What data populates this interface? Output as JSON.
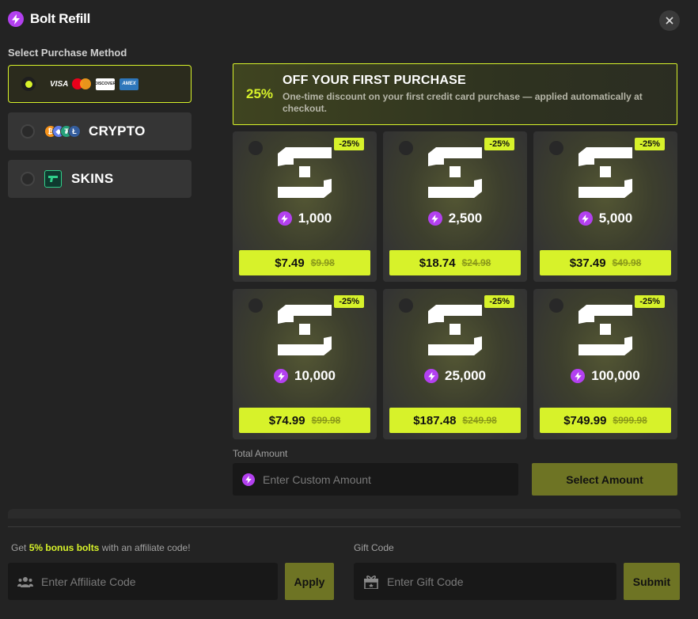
{
  "header": {
    "title": "Bolt Refill",
    "icon": "bolt-icon",
    "close_icon": "close-icon"
  },
  "purchase_method": {
    "label": "Select Purchase Method",
    "options": [
      {
        "id": "card",
        "cards": [
          "VISA",
          "mastercard",
          "DISCOVER",
          "AMEX"
        ],
        "selected": true
      },
      {
        "id": "crypto",
        "label": "CRYPTO",
        "selected": false
      },
      {
        "id": "skins",
        "label": "SKINS",
        "selected": false
      }
    ]
  },
  "promo": {
    "percent": "25%",
    "title": "OFF YOUR FIRST PURCHASE",
    "description": "One-time discount on your first credit card purchase — applied automatically at checkout."
  },
  "packages": [
    {
      "badge": "-25%",
      "amount": "1,000",
      "price": "$7.49",
      "old_price": "$9.98"
    },
    {
      "badge": "-25%",
      "amount": "2,500",
      "price": "$18.74",
      "old_price": "$24.98"
    },
    {
      "badge": "-25%",
      "amount": "5,000",
      "price": "$37.49",
      "old_price": "$49.98"
    },
    {
      "badge": "-25%",
      "amount": "10,000",
      "price": "$74.99",
      "old_price": "$99.98"
    },
    {
      "badge": "-25%",
      "amount": "25,000",
      "price": "$187.48",
      "old_price": "$249.98"
    },
    {
      "badge": "-25%",
      "amount": "100,000",
      "price": "$749.99",
      "old_price": "$999.98"
    }
  ],
  "custom": {
    "label": "Total Amount",
    "placeholder": "Enter Custom Amount",
    "button": "Select Amount"
  },
  "affiliate": {
    "prefix": "Get ",
    "highlight": "5% bonus bolts",
    "suffix": " with an affiliate code!",
    "placeholder": "Enter Affiliate Code",
    "button": "Apply"
  },
  "gift": {
    "label": "Gift Code",
    "placeholder": "Enter Gift Code",
    "button": "Submit"
  },
  "colors": {
    "accent": "#d7f22a",
    "bolt": "#b340f0",
    "background": "#232323",
    "button_muted": "#6e7424"
  }
}
